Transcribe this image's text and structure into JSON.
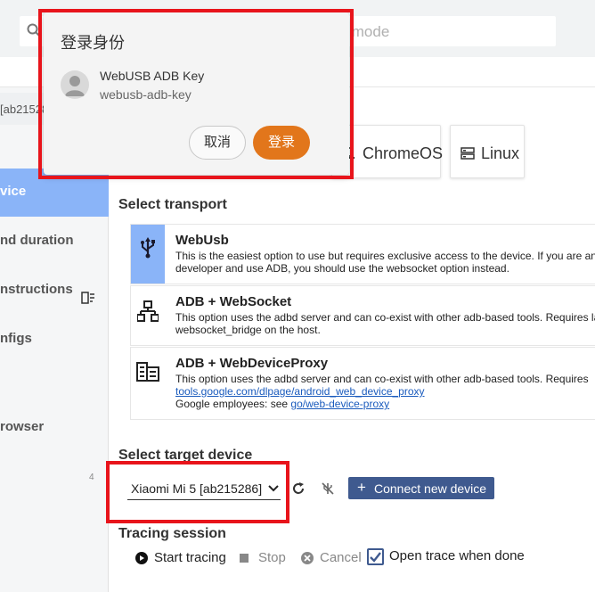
{
  "search": {
    "placeholder_fragment": "QL mode"
  },
  "sidebar": {
    "device_label": "[ab215286]",
    "items": [
      {
        "label": "vice",
        "active": true
      },
      {
        "label": "nd duration"
      },
      {
        "label": "nstructions"
      },
      {
        "label": "nfigs"
      },
      {
        "label": "rowser"
      }
    ],
    "number": "4"
  },
  "platforms": [
    {
      "label": "ChromeOS",
      "icon": "laptop-icon"
    },
    {
      "label": "Linux",
      "icon": "server-icon"
    }
  ],
  "transport_section": {
    "title": "Select transport",
    "items": [
      {
        "name": "WebUsb",
        "icon": "usb-icon",
        "desc1": "This is the easiest option to use but requires exclusive access to the device. If you are an",
        "desc2": "developer and use ADB, you should use the websocket option instead.",
        "active": true
      },
      {
        "name": "ADB + WebSocket",
        "icon": "lan-icon",
        "desc1": "This option uses the adbd server and can co-exist with other adb-based tools. Requires la",
        "desc2": "websocket_bridge on the host."
      },
      {
        "name": "ADB + WebDeviceProxy",
        "icon": "proxy-icon",
        "desc1": "This option uses the adbd server and can co-exist with other adb-based tools. Requires",
        "link1": "tools.google.com/dlpage/android_web_device_proxy",
        "desc3_prefix": "Google employees: see ",
        "link2": "go/web-device-proxy"
      }
    ]
  },
  "target_section": {
    "title": "Select target device",
    "selected_device": "Xiaomi Mi 5 [ab215286]",
    "connect_label": "Connect new device"
  },
  "tracing_section": {
    "title": "Tracing session",
    "start_label": "Start tracing",
    "stop_label": "Stop",
    "cancel_label": "Cancel",
    "open_trace_label": "Open trace when done",
    "open_trace_checked": true
  },
  "login_popup": {
    "title": "登录身份",
    "account_name": "WebUSB ADB Key",
    "account_id": "webusb-adb-key",
    "cancel_label": "取消",
    "login_label": "登录"
  },
  "colors": {
    "accent": "#8ab4f8",
    "primary_button": "#3f5a8f",
    "login_button": "#e2761b",
    "highlight": "#e8141b"
  }
}
